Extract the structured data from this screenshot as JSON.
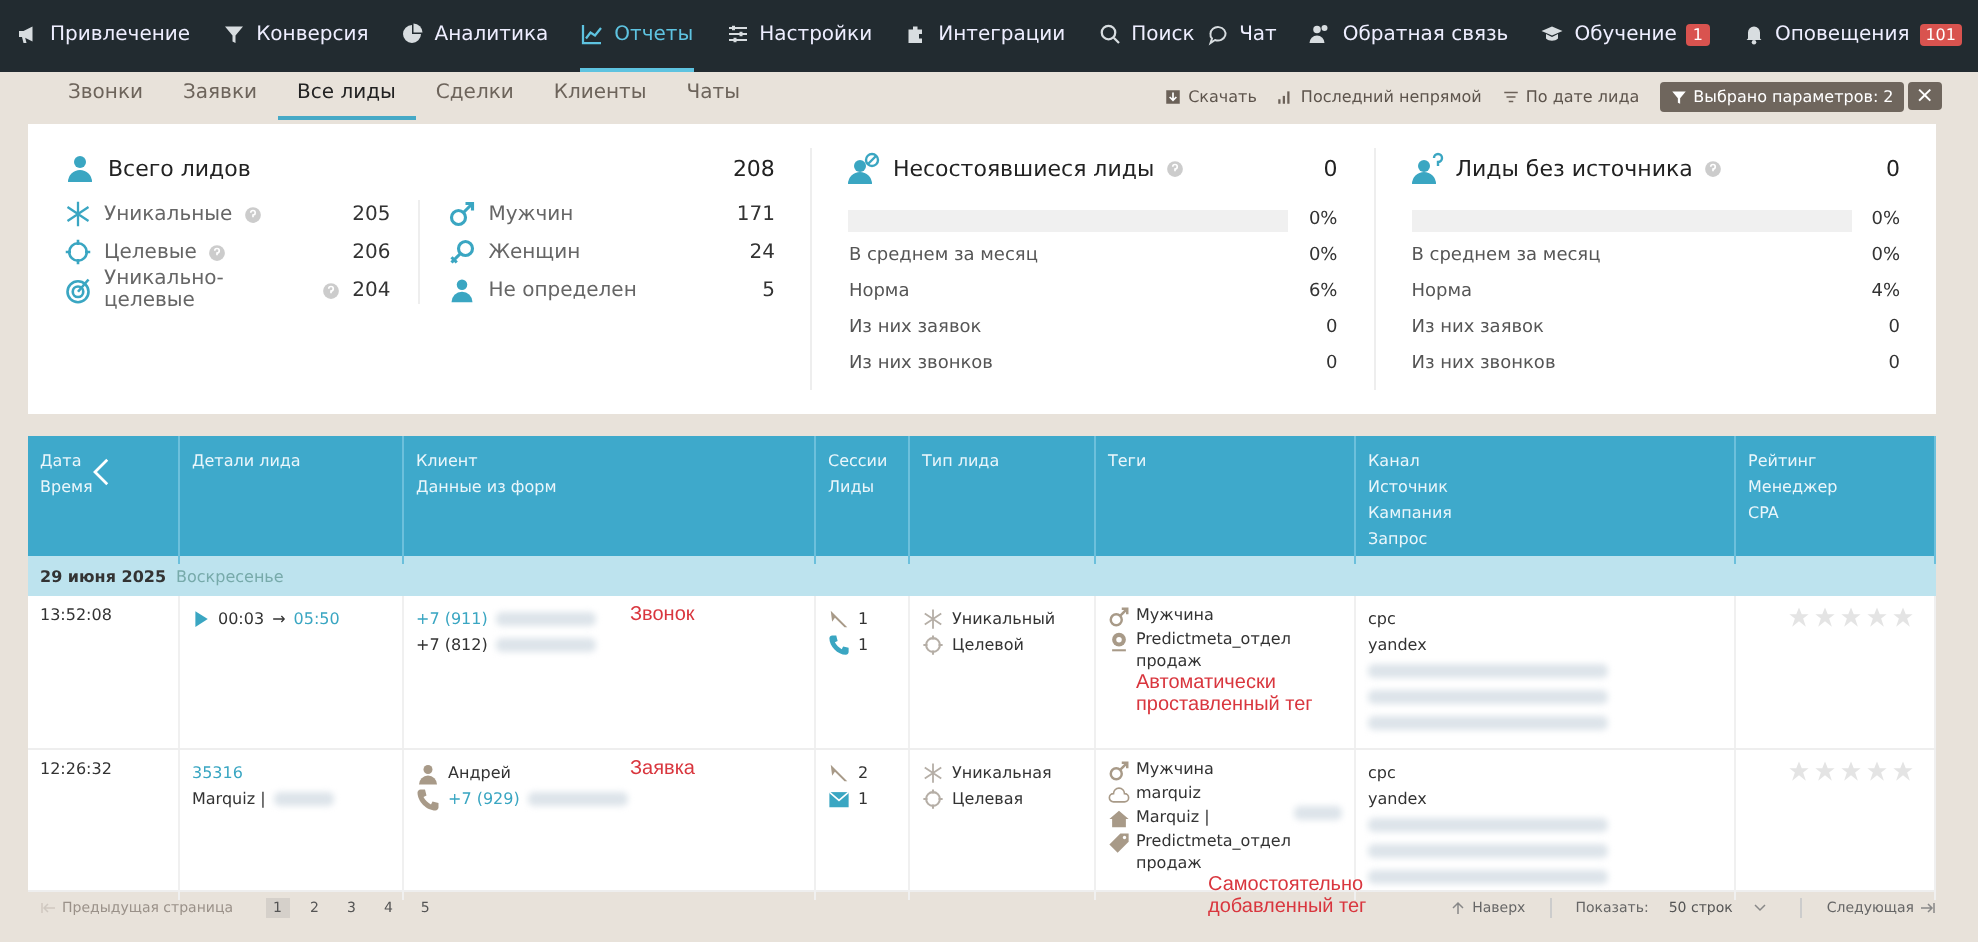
{
  "nav": {
    "items": [
      {
        "kind": "megaphone",
        "label": "Привлечение",
        "selected": false
      },
      {
        "kind": "conversion",
        "label": "Конверсия",
        "selected": false
      },
      {
        "kind": "pie",
        "label": "Аналитика",
        "selected": false
      },
      {
        "kind": "chart",
        "label": "Отчеты",
        "selected": true
      },
      {
        "kind": "sliders",
        "label": "Настройки",
        "selected": false
      },
      {
        "kind": "puzzle",
        "label": "Интеграции",
        "selected": false
      },
      {
        "kind": "search",
        "label": "Поиск",
        "selected": false
      }
    ],
    "right": [
      {
        "kind": "chat",
        "label": "Чат"
      },
      {
        "kind": "feedback",
        "label": "Обратная связь"
      },
      {
        "kind": "cap",
        "label": "Обучение",
        "badge": "1"
      },
      {
        "kind": "bell",
        "label": "Оповещения",
        "badge": "101"
      }
    ]
  },
  "tabs": [
    {
      "label": "Звонки",
      "selected": false
    },
    {
      "label": "Заявки",
      "selected": false
    },
    {
      "label": "Все лиды",
      "selected": true
    },
    {
      "label": "Сделки",
      "selected": false
    },
    {
      "label": "Клиенты",
      "selected": false
    },
    {
      "label": "Чаты",
      "selected": false
    }
  ],
  "tools": [
    {
      "kind": "download",
      "label": "Скачать"
    },
    {
      "kind": "bars",
      "label": "Последний непрямой"
    },
    {
      "kind": "sort",
      "label": "По дате лида"
    }
  ],
  "filter": {
    "label": "Выбрано параметров: 2",
    "close": "×"
  },
  "summary": {
    "title": "Всего лидов",
    "value": "208",
    "types": [
      {
        "kind": "unique",
        "label": "Уникальные",
        "help": true,
        "value": "205"
      },
      {
        "kind": "target",
        "label": "Целевые",
        "help": true,
        "value": "206"
      },
      {
        "kind": "unique-target",
        "label": "Уникально-целевые",
        "help": true,
        "value": "204"
      }
    ],
    "genders": [
      {
        "kind": "male",
        "label": "Мужчин",
        "value": "171"
      },
      {
        "kind": "female",
        "label": "Женщин",
        "value": "24"
      },
      {
        "kind": "person",
        "label": "Не определен",
        "value": "5"
      }
    ]
  },
  "panels": [
    {
      "kind": "failed",
      "title": "Несостоявшиеся лиды",
      "help": true,
      "value": "0",
      "level": 0,
      "percent": "0%",
      "rows": [
        {
          "label": "В среднем за месяц",
          "value": "0%"
        },
        {
          "label": "Норма",
          "value": "6%"
        },
        {
          "label": "Из них заявок",
          "value": "0"
        },
        {
          "label": "Из них звонков",
          "value": "0"
        }
      ]
    },
    {
      "kind": "nosource",
      "title": "Лиды без источника",
      "help": true,
      "value": "0",
      "level": 0,
      "percent": "0%",
      "rows": [
        {
          "label": "В среднем за месяц",
          "value": "0%"
        },
        {
          "label": "Норма",
          "value": "4%"
        },
        {
          "label": "Из них заявок",
          "value": "0"
        },
        {
          "label": "Из них звонков",
          "value": "0"
        }
      ]
    }
  ],
  "table": {
    "columns": [
      {
        "lines": [
          "Дата",
          "Время"
        ]
      },
      {
        "lines": [
          "Детали лида"
        ]
      },
      {
        "lines": [
          "Клиент",
          "Данные из форм"
        ]
      },
      {
        "lines": [
          "Сессии",
          "Лиды"
        ]
      },
      {
        "lines": [
          "Тип лида"
        ]
      },
      {
        "lines": [
          "Теги"
        ]
      },
      {
        "lines": [
          "Канал",
          "Источник",
          "Кампания",
          "Запрос"
        ]
      },
      {
        "lines": [
          "Рейтинг",
          "Менеджер",
          "CPA"
        ]
      }
    ],
    "group": {
      "date": "29 июня 2025",
      "weekday": "Воскресенье"
    },
    "rows": [
      {
        "time": "13:52:08",
        "details": {
          "kind": "call",
          "start": "00:03",
          "arrow": "→",
          "end": "05:50"
        },
        "client": [
          {
            "kind": "phone-link",
            "text": "+7 (911)",
            "redacted": true
          },
          {
            "kind": "phone",
            "text": "+7 (812)",
            "redacted": true
          }
        ],
        "annotation": "Звонок",
        "sessions": [
          {
            "kind": "visits",
            "count": "1"
          },
          {
            "kind": "call",
            "count": "1"
          }
        ],
        "lead_types": [
          {
            "kind": "unique",
            "label": "Уникальный"
          },
          {
            "kind": "target",
            "label": "Целевой"
          }
        ],
        "tags": [
          {
            "kind": "male",
            "text": "Мужчина"
          },
          {
            "kind": "auto",
            "text": "Predictmeta_отдел продаж"
          }
        ],
        "tag_annotation": "Автоматически проставленный тег",
        "channel": [
          {
            "kind": "text",
            "text": "cpc"
          },
          {
            "kind": "text",
            "text": "yandex"
          },
          {
            "kind": "redacted"
          },
          {
            "kind": "redacted"
          },
          {
            "kind": "redacted"
          }
        ],
        "stars": 0
      },
      {
        "time": "12:26:32",
        "details": {
          "kind": "form",
          "id": "35316",
          "source": "Marquiz |",
          "redacted": true
        },
        "client": [
          {
            "kind": "person",
            "text": "Андрей"
          },
          {
            "kind": "phone-link-icon",
            "text": "+7 (929)",
            "redacted": true
          }
        ],
        "annotation": "Заявка",
        "sessions": [
          {
            "kind": "visits",
            "count": "2"
          },
          {
            "kind": "form",
            "count": "1"
          }
        ],
        "lead_types": [
          {
            "kind": "unique",
            "label": "Уникальная"
          },
          {
            "kind": "target",
            "label": "Целевая"
          }
        ],
        "tags": [
          {
            "kind": "male",
            "text": "Мужчина"
          },
          {
            "kind": "cloud",
            "text": "marquiz"
          },
          {
            "kind": "home",
            "text": "Marquiz |",
            "redacted": true
          },
          {
            "kind": "tag",
            "text": "Predictmeta_отдел продаж"
          }
        ],
        "tag_annotation": "Самостоятельно добавленный тег",
        "channel": [
          {
            "kind": "text",
            "text": "cpc"
          },
          {
            "kind": "text",
            "text": "yandex"
          },
          {
            "kind": "redacted"
          },
          {
            "kind": "redacted"
          },
          {
            "kind": "redacted"
          }
        ],
        "stars": 0
      }
    ]
  },
  "pagination": {
    "prev": {
      "label": "Предыдущая страница",
      "disabled": true
    },
    "pages": [
      {
        "label": "1",
        "selected": true
      },
      {
        "label": "2",
        "selected": false
      },
      {
        "label": "3",
        "selected": false
      },
      {
        "label": "4",
        "selected": false
      },
      {
        "label": "5",
        "selected": false
      }
    ],
    "top": "Наверх",
    "show_label": "Показать:",
    "show_value": "50 строк",
    "next": "Следующая"
  }
}
